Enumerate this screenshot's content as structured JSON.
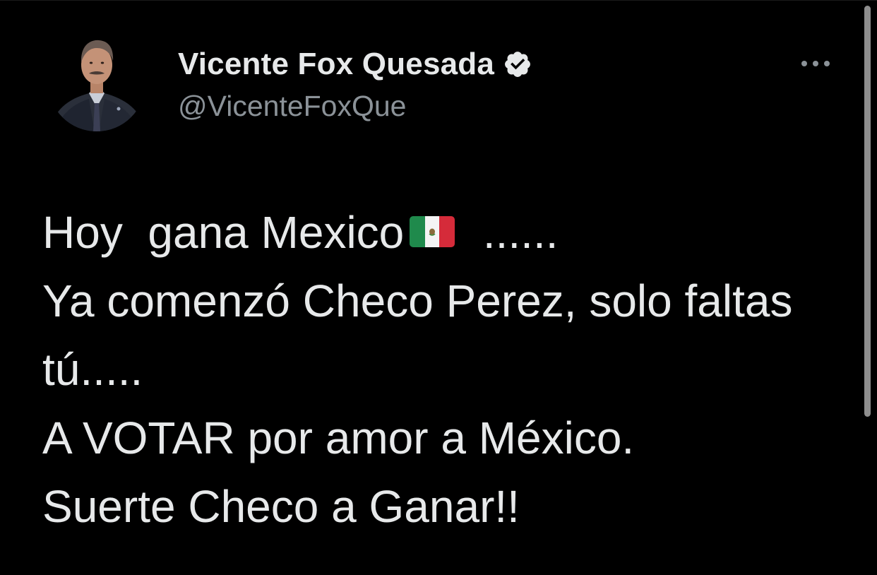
{
  "tweet": {
    "author": {
      "display_name": "Vicente Fox Quesada",
      "handle": "@VicenteFoxQue",
      "verified_icon": "verified-badge-icon",
      "avatar_icon": "profile-photo"
    },
    "more_icon": "more-options-icon",
    "lines": [
      {
        "before_flag": "Hoy  gana Mexico",
        "flag_icon": "mexico-flag-emoji",
        "after_flag": "  ......"
      },
      {
        "text": "Ya comenzó Checo Perez,  solo faltas"
      },
      {
        "text": "tú....."
      },
      {
        "text": "A VOTAR por amor a México."
      },
      {
        "text": "Suerte Checo a Ganar!!"
      }
    ]
  },
  "colors": {
    "background": "#000000",
    "primary_text": "#e7e9ea",
    "secondary_text": "#8b9298",
    "scrollbar": "#8e8e8e"
  }
}
